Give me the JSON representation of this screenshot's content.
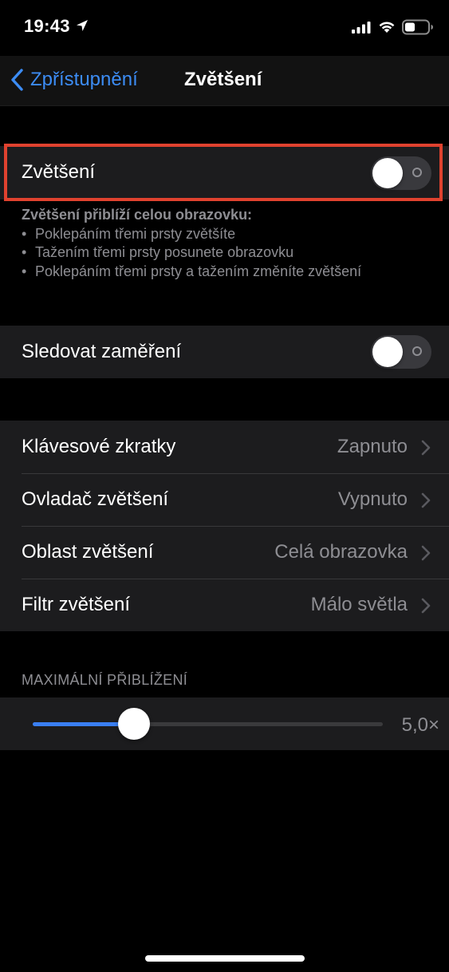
{
  "status_bar": {
    "time": "19:43",
    "icons": [
      "location-arrow-icon",
      "cellular-signal-icon",
      "wifi-icon",
      "battery-icon"
    ]
  },
  "nav": {
    "back_label": "Zpřístupnění",
    "title": "Zvětšení"
  },
  "zoom_toggle": {
    "label": "Zvětšení",
    "on": false
  },
  "zoom_description": {
    "title": "Zvětšení přiblíží celou obrazovku:",
    "bullets": [
      "Poklepáním třemi prsty zvětšíte",
      "Tažením třemi prsty posunete obrazovku",
      "Poklepáním třemi prsty a tažením změníte zvětšení"
    ]
  },
  "follow_focus": {
    "label": "Sledovat zaměření",
    "on": false
  },
  "options": [
    {
      "label": "Klávesové zkratky",
      "value": "Zapnuto"
    },
    {
      "label": "Ovladač zvětšení",
      "value": "Vypnuto"
    },
    {
      "label": "Oblast zvětšení",
      "value": "Celá obrazovka"
    },
    {
      "label": "Filtr zvětšení",
      "value": "Málo světla"
    }
  ],
  "max_zoom": {
    "header": "MAXIMÁLNÍ PŘIBLÍŽENÍ",
    "value_label": "5,0×",
    "level": 0.29
  },
  "colors": {
    "accent": "#3c8cf4",
    "highlight_border": "#e0422f",
    "cell_background": "#1c1c1e",
    "secondary_text": "#8e8e93"
  }
}
